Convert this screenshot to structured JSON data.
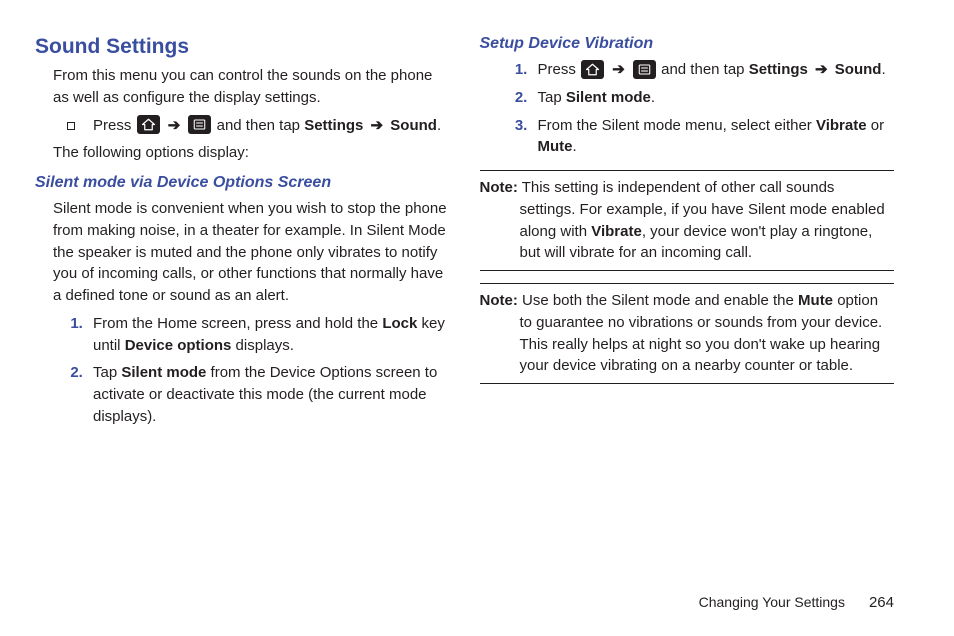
{
  "left": {
    "heading": "Sound Settings",
    "intro": "From this menu you can control the sounds on the phone as well as configure the display settings.",
    "pressLine": {
      "prefix": "Press ",
      "sep": " ➔ ",
      "tail1": " and then tap ",
      "boldSettings": "Settings",
      "sep2": " ➔ ",
      "boldSound": "Sound",
      "period": "."
    },
    "optionsLine": "The following options display:",
    "silentHeading": "Silent mode via Device Options Screen",
    "silentBody": "Silent mode is convenient when you wish to stop the phone from making noise, in a theater for example. In Silent Mode the speaker is muted and the phone only vibrates to notify you of incoming calls, or other functions that normally have a defined tone or sound as an alert.",
    "steps": {
      "s1a": "From the Home screen, press and hold the ",
      "s1bold1": "Lock",
      "s1b": " key until ",
      "s1bold2": "Device options",
      "s1c": " displays.",
      "s2a": "Tap ",
      "s2bold": "Silent mode",
      "s2b": " from the Device Options screen to activate or deactivate this mode (the current mode displays)."
    }
  },
  "right": {
    "setupHeading": "Setup Device Vibration",
    "steps": {
      "s1a": "Press ",
      "sep": " ➔ ",
      "s1b": " and then tap ",
      "boldSettings": "Settings",
      "sep2": " ➔ ",
      "boldSound": "Sound",
      "period": ".",
      "s2a": "Tap ",
      "s2bold": "Silent mode",
      "s2b": ".",
      "s3a": "From the Silent mode menu, select either ",
      "s3bold1": "Vibrate",
      "s3b": " or ",
      "s3bold2": "Mute",
      "s3c": "."
    },
    "note1": {
      "label": "Note:",
      "a": " This setting is independent of other call sounds settings. For example, if you have Silent mode enabled along with ",
      "bold": "Vibrate",
      "b": ", your device won't play a ringtone, but will vibrate for an incoming call."
    },
    "note2": {
      "label": "Note:",
      "a": " Use both the Silent mode and enable the ",
      "bold": "Mute",
      "b": " option to guarantee no vibrations or sounds from your device. This really helps at night so you don't wake up hearing your device vibrating on a nearby counter or table."
    }
  },
  "footer": {
    "chapter": "Changing Your Settings",
    "page": "264"
  }
}
